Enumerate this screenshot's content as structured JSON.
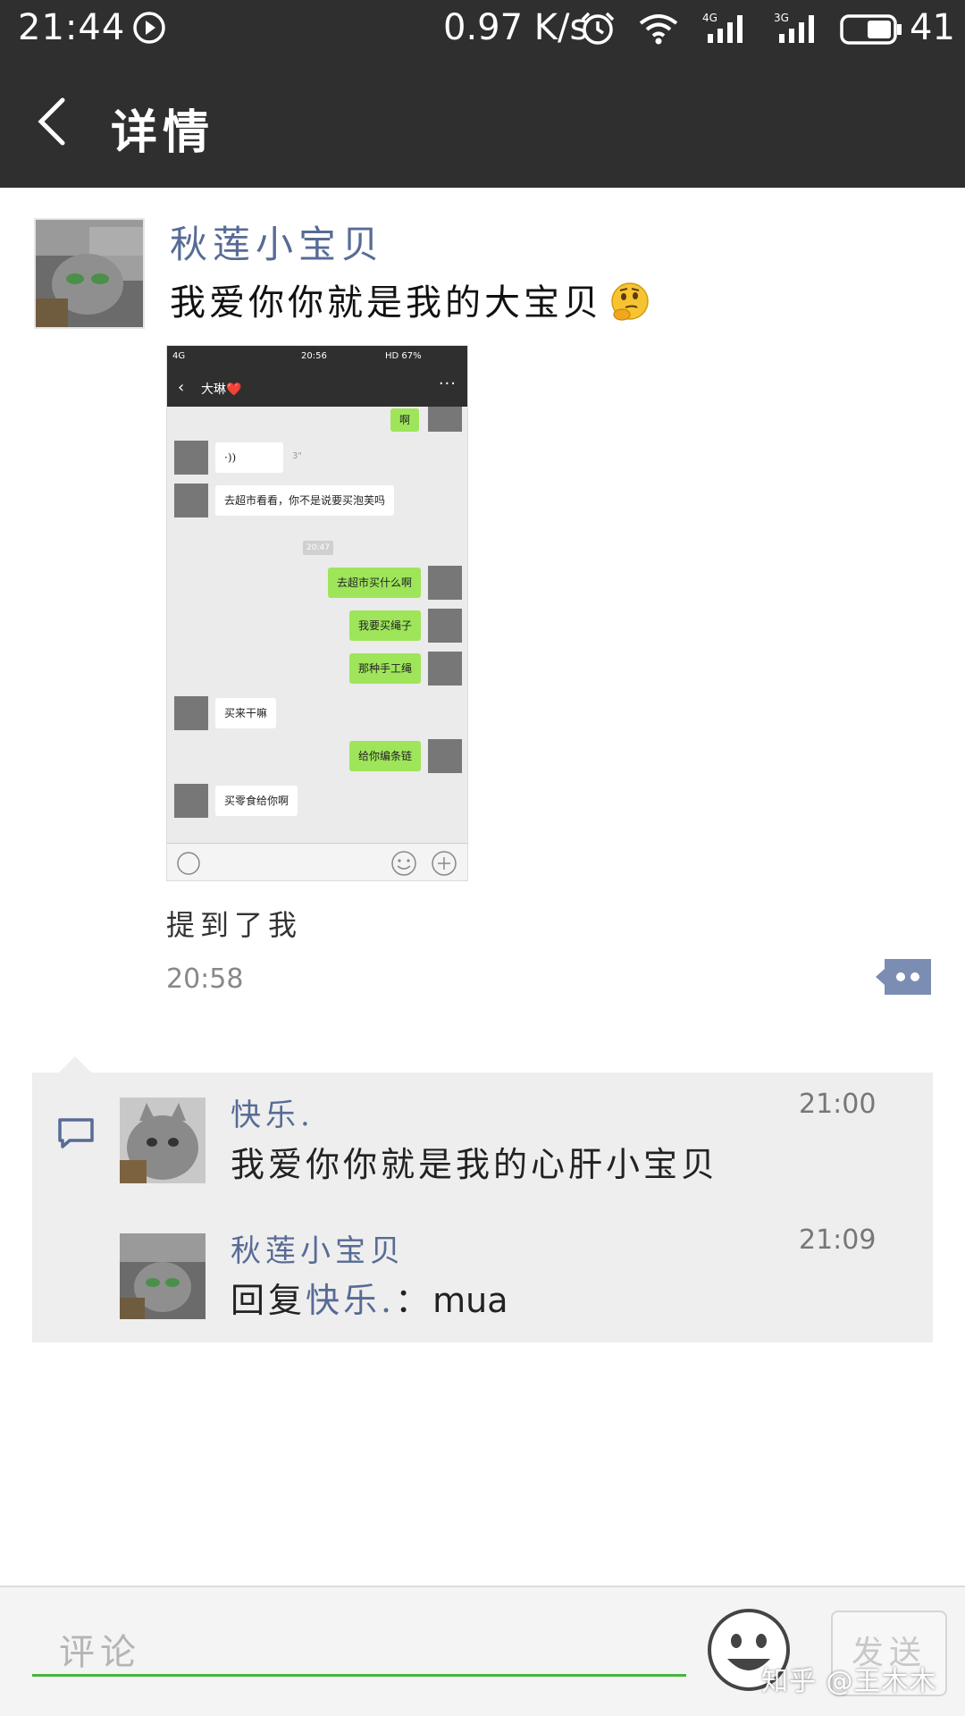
{
  "status_bar": {
    "time": "21:44",
    "net_speed": "0.97 K/s",
    "network_1": "4G",
    "network_2": "3G",
    "battery": "41"
  },
  "header": {
    "title": "详情"
  },
  "post": {
    "author": "秋莲小宝贝",
    "text": "我爱你你就是我的大宝贝",
    "emoji_icon": "thinking-face-emoji",
    "mention_text": "提到了我",
    "time": "20:58"
  },
  "embedded_screenshot": {
    "status_time": "20:56",
    "status_signal": "4G",
    "status_right": "HD 67%",
    "chat_title": "大琳❤️",
    "more": "···",
    "messages": [
      {
        "side": "right",
        "text": "啊"
      },
      {
        "side": "left",
        "text": "·))",
        "duration": "3\""
      },
      {
        "side": "left",
        "text": "去超市看看，你不是说要买泡芙吗"
      },
      {
        "side": "center",
        "text": "20:47"
      },
      {
        "side": "right",
        "text": "去超市买什么啊"
      },
      {
        "side": "right",
        "text": "我要买绳子"
      },
      {
        "side": "right",
        "text": "那种手工绳"
      },
      {
        "side": "left",
        "text": "买来干嘛"
      },
      {
        "side": "right",
        "text": "给你编条链"
      },
      {
        "side": "left",
        "text": "买零食给你啊"
      }
    ]
  },
  "comments": [
    {
      "author": "快乐.",
      "text": "我爱你你就是我的心肝小宝贝",
      "time": "21:00"
    },
    {
      "author": "秋莲小宝贝",
      "reply_prefix": "回复",
      "reply_to": "快乐.",
      "reply_sep": "：",
      "text": "mua",
      "time": "21:09"
    }
  ],
  "comment_bar": {
    "placeholder": "评论",
    "send_label": "发送"
  },
  "watermark": "知乎 @王木木",
  "colors": {
    "header_bg": "#2f2f2f",
    "name_link": "#576b95",
    "bubble_green": "#9ee55a",
    "input_underline": "#46b53c"
  }
}
